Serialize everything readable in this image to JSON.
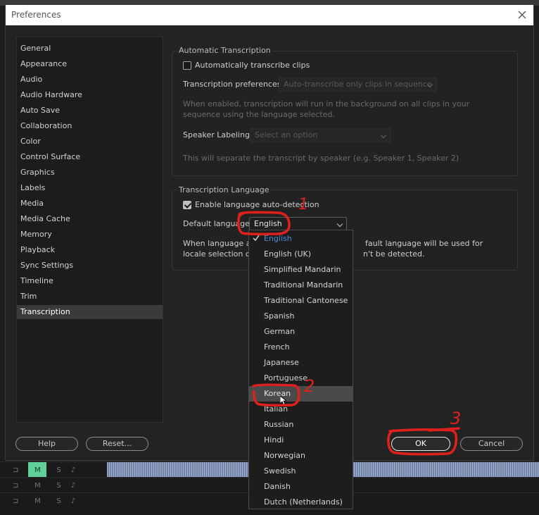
{
  "dialog": {
    "title": "Preferences"
  },
  "sidebar": {
    "items": [
      {
        "label": "General"
      },
      {
        "label": "Appearance"
      },
      {
        "label": "Audio"
      },
      {
        "label": "Audio Hardware"
      },
      {
        "label": "Auto Save"
      },
      {
        "label": "Collaboration"
      },
      {
        "label": "Color"
      },
      {
        "label": "Control Surface"
      },
      {
        "label": "Graphics"
      },
      {
        "label": "Labels"
      },
      {
        "label": "Media"
      },
      {
        "label": "Media Cache"
      },
      {
        "label": "Memory"
      },
      {
        "label": "Playback"
      },
      {
        "label": "Sync Settings"
      },
      {
        "label": "Timeline"
      },
      {
        "label": "Trim"
      },
      {
        "label": "Transcription"
      }
    ],
    "selected": "Transcription"
  },
  "auto_transcription": {
    "legend": "Automatic Transcription",
    "auto_transcribe_label": "Automatically transcribe clips",
    "auto_transcribe_checked": false,
    "prefs_label": "Transcription preferences:",
    "prefs_value": "Auto-transcribe only clips in sequence",
    "note_line1": "When enabled, transcription will run in the background on all clips in your",
    "note_line2": "sequence using the language selected.",
    "speaker_label": "Speaker Labeling:",
    "speaker_placeholder": "Select an option",
    "speaker_note": "This will separate the transcript by speaker (e.g. Speaker 1, Speaker 2)"
  },
  "transcription_language": {
    "legend": "Transcription Language",
    "auto_detect_label": "Enable language auto-detection",
    "auto_detect_checked": true,
    "default_language_label": "Default language:",
    "default_language_value": "English",
    "note_line1_start": "When language au",
    "note_line1_end": "fault language will be used for",
    "note_line2_start": "locale selection or",
    "note_line2_end": "n't be detected."
  },
  "language_dropdown": {
    "options": [
      "English",
      "English (UK)",
      "Simplified Mandarin",
      "Traditional Mandarin",
      "Traditional Cantonese",
      "Spanish",
      "German",
      "French",
      "Japanese",
      "Portuguese",
      "Korean",
      "Italian",
      "Russian",
      "Hindi",
      "Norwegian",
      "Swedish",
      "Danish",
      "Dutch (Netherlands)"
    ],
    "selected": "English",
    "hovered": "Korean"
  },
  "buttons": {
    "help": "Help",
    "reset": "Reset...",
    "ok": "OK",
    "cancel": "Cancel"
  },
  "annotations": {
    "step1": "1",
    "step2": "2",
    "step3": "3",
    "color": "#e0201e"
  },
  "background": {
    "track_buttons": [
      "M",
      "S"
    ]
  }
}
